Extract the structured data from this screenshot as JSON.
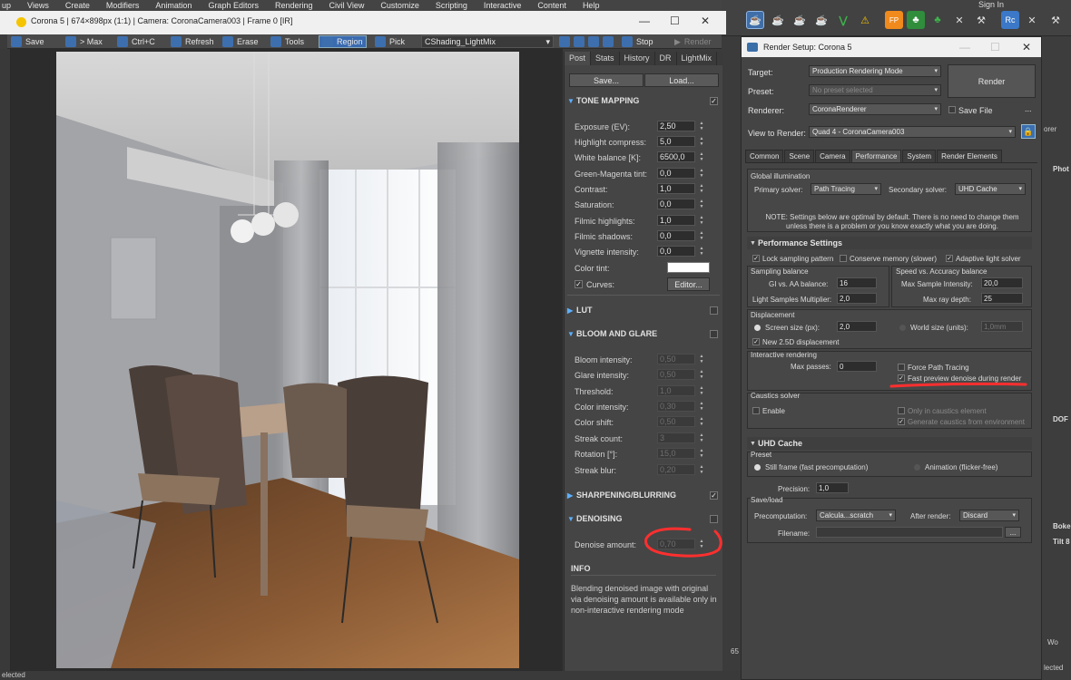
{
  "menu": [
    "up",
    "Views",
    "Create",
    "Modifiers",
    "Animation",
    "Graph Editors",
    "Rendering",
    "Civil View",
    "Customize",
    "Scripting",
    "Interactive",
    "Content",
    "Help"
  ],
  "signin": "Sign In",
  "vfb": {
    "title": "Corona 5 | 674×898px (1:1) | Camera: CoronaCamera003 | Frame 0 [IR]",
    "toolbar": {
      "save": "Save",
      "max": "> Max",
      "ctrlc": "Ctrl+C",
      "refresh": "Refresh",
      "erase": "Erase",
      "tools": "Tools",
      "region": "Region",
      "pick": "Pick",
      "lightmix": "CShading_LightMix",
      "stop": "Stop",
      "render": "Render"
    },
    "tabs": [
      "Post",
      "Stats",
      "History",
      "DR",
      "LightMix"
    ],
    "save_btn": "Save...",
    "load_btn": "Load...",
    "tone_mapping": {
      "title": "TONE MAPPING",
      "rows": [
        {
          "label": "Exposure (EV):",
          "value": "2,50"
        },
        {
          "label": "Highlight compress:",
          "value": "5,0"
        },
        {
          "label": "White balance [K]:",
          "value": "6500,0"
        },
        {
          "label": "Green-Magenta tint:",
          "value": "0,0"
        },
        {
          "label": "Contrast:",
          "value": "1,0"
        },
        {
          "label": "Saturation:",
          "value": "0,0"
        },
        {
          "label": "Filmic highlights:",
          "value": "1,0"
        },
        {
          "label": "Filmic shadows:",
          "value": "0,0"
        },
        {
          "label": "Vignette intensity:",
          "value": "0,0"
        }
      ],
      "color_tint": "Color tint:",
      "curves": "Curves:",
      "editor": "Editor..."
    },
    "lut": "LUT",
    "bloom": {
      "title": "BLOOM AND GLARE",
      "rows": [
        {
          "label": "Bloom intensity:",
          "value": "0,50"
        },
        {
          "label": "Glare intensity:",
          "value": "0,50"
        },
        {
          "label": "Threshold:",
          "value": "1,0"
        },
        {
          "label": "Color intensity:",
          "value": "0,30"
        },
        {
          "label": "Color shift:",
          "value": "0,50"
        },
        {
          "label": "Streak count:",
          "value": "3"
        },
        {
          "label": "Rotation [°]:",
          "value": "15,0"
        },
        {
          "label": "Streak blur:",
          "value": "0,20"
        }
      ]
    },
    "sharpening": "SHARPENING/BLURRING",
    "denoising": {
      "title": "DENOISING",
      "label": "Denoise amount:",
      "value": "0,70"
    },
    "info": {
      "title": "INFO",
      "text": "Blending denoised image with original via denoising amount is available only in non-interactive rendering mode"
    }
  },
  "render_setup": {
    "title": "Render Setup: Corona 5",
    "target_label": "Target:",
    "target_value": "Production Rendering Mode",
    "preset_label": "Preset:",
    "preset_value": "No preset selected",
    "renderer_label": "Renderer:",
    "renderer_value": "CoronaRenderer",
    "save_file": "Save File",
    "view_label": "View to Render:",
    "view_value": "Quad 4 - CoronaCamera003",
    "render_btn": "Render",
    "ellipsis": "...",
    "tabs": [
      "Common",
      "Scene",
      "Camera",
      "Performance",
      "System",
      "Render Elements"
    ],
    "gi": {
      "title": "Global illumination",
      "primary_label": "Primary solver:",
      "primary_value": "Path Tracing",
      "secondary_label": "Secondary solver:",
      "secondary_value": "UHD Cache",
      "note": "NOTE: Settings below are optimal by default. There is no need to change them unless there is a problem or you know exactly what you are doing."
    },
    "perf": {
      "title": "Performance Settings",
      "lock": "Lock sampling pattern",
      "conserve": "Conserve memory (slower)",
      "adaptive": "Adaptive light solver",
      "sampling_balance": "Sampling balance",
      "gi_aa_label": "GI vs. AA balance:",
      "gi_aa_value": "16",
      "light_samples_label": "Light Samples Multiplier:",
      "light_samples_value": "2,0",
      "speed_accuracy": "Speed vs. Accuracy balance",
      "max_sample_label": "Max Sample Intensity:",
      "max_sample_value": "20,0",
      "max_ray_label": "Max ray depth:",
      "max_ray_value": "25",
      "displacement": "Displacement",
      "screen_size_label": "Screen size (px):",
      "screen_size_value": "2,0",
      "world_size_label": "World size (units):",
      "world_size_value": "1,0mm",
      "new_disp": "New 2.5D displacement",
      "interactive": "Interactive rendering",
      "max_passes_label": "Max passes:",
      "max_passes_value": "0",
      "force_pt": "Force Path Tracing",
      "fast_preview": "Fast preview denoise during render",
      "caustics": "Caustics solver",
      "enable": "Enable",
      "only_caustics": "Only in caustics element",
      "generate_caustics": "Generate caustics from environment"
    },
    "uhd": {
      "title": "UHD Cache",
      "preset": "Preset",
      "still": "Still frame (fast precomputation)",
      "animation": "Animation (flicker-free)",
      "precision_label": "Precision:",
      "precision_value": "1,0",
      "saveload": "Save/load",
      "precomp_label": "Precomputation:",
      "precomp_value": "Calcula...scratch",
      "after_label": "After render:",
      "after_value": "Discard",
      "filename_label": "Filename:",
      "browse": "..."
    }
  },
  "side": {
    "orer": "orer",
    "phot": "Phot",
    "dof": "DOF",
    "boke": "Boke",
    "tilt": "Tilt 8",
    "num65": "65",
    "selected": "elected",
    "lected": "lected",
    "wo": "Wo"
  }
}
